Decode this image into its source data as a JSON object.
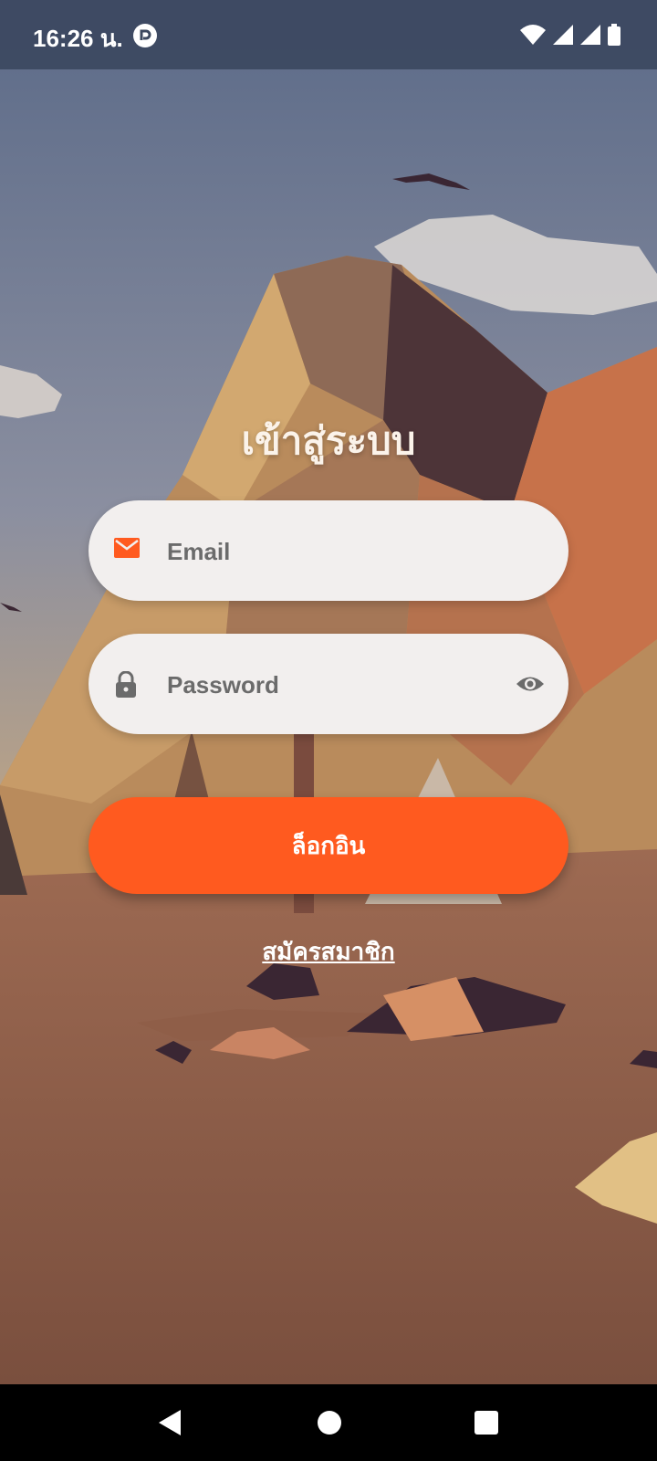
{
  "status_bar": {
    "time": "16:26 น.",
    "icons": [
      "app-notification-icon",
      "wifi-icon",
      "signal-icon",
      "signal-icon",
      "battery-icon"
    ]
  },
  "login": {
    "title": "เข้าสู่ระบบ",
    "email_placeholder": "Email",
    "password_placeholder": "Password",
    "login_button": "ล็อกอิน",
    "register_link": "สมัครสมาชิก"
  },
  "colors": {
    "accent": "#ff5a1f",
    "field_background": "#f2efee",
    "status_bar": "#3c485f"
  },
  "nav_bar": {
    "icons": [
      "back-icon",
      "home-icon",
      "recents-icon"
    ]
  }
}
